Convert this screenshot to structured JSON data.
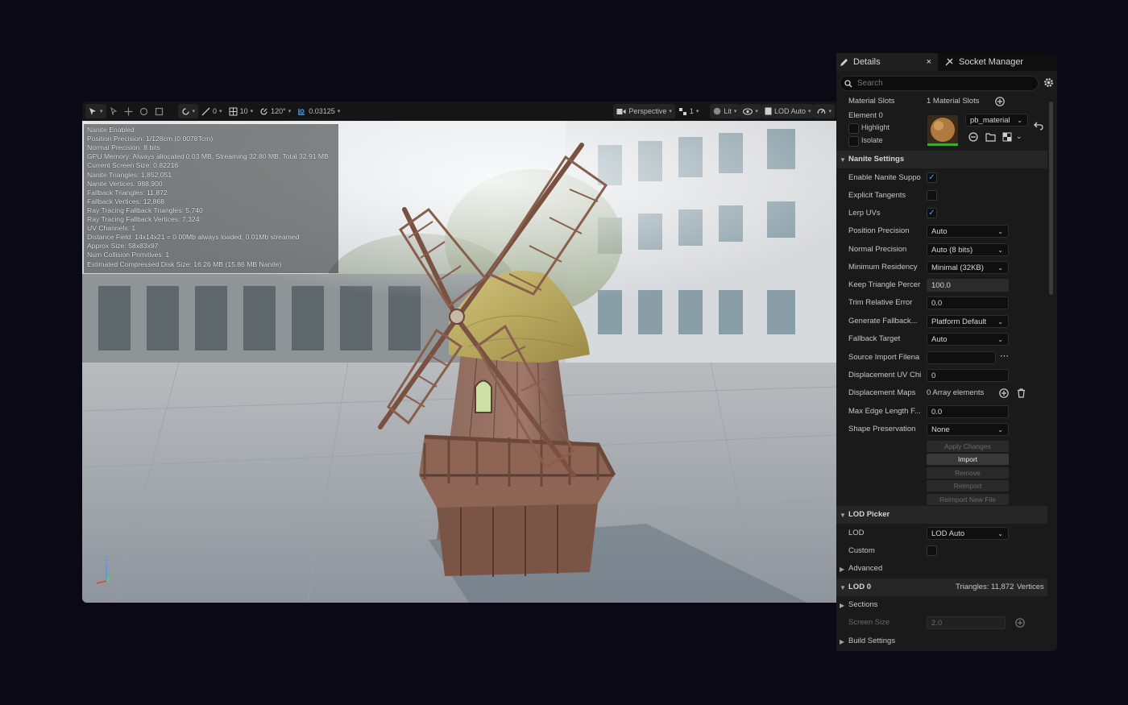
{
  "viewport": {
    "toolbar": {
      "snap_rotate": "0",
      "snap_grid": "10",
      "snap_angle": "120°",
      "camera_speed": "0.03125",
      "view_mode": "Perspective",
      "layout": "1",
      "lighting": "Lit",
      "lod": "LOD Auto"
    },
    "stats": [
      "Nanite Enabled",
      "Position Precision: 1/128cm (0.0078Tcm)",
      "Normal Precision: 8 bits",
      "GPU Memory: Always allocated 0.03 MB, Streaming 32.80 MB, Total 32.91 MB",
      "Current Screen Size: 0.82216",
      "Nanite Triangles: 1,852,051",
      "Nanite Vertices: 988,900",
      "Fallback Triangles: 11,872",
      "Fallback Vertices: 12,868",
      "Ray Tracing Fallback Triangles: 5,740",
      "Ray Tracing Fallback Vertices: 7,324",
      "UV Channels: 1",
      "Distance Field: 14x14x21 = 0.00Mb always loaded, 0.01Mb streamed",
      "Approx Size: 58x83x97",
      "Num Collision Primitives: 1",
      "Estimated Compressed Disk Size: 16.26 MB (15.86 MB Nanite)"
    ],
    "axis": {
      "z": "Z"
    }
  },
  "panel": {
    "tabs": {
      "details": "Details",
      "close": "×",
      "socket_manager": "Socket Manager"
    },
    "search_placeholder": "Search",
    "material_slots": {
      "label": "Material Slots",
      "value": "1 Material Slots"
    },
    "element": {
      "label": "Element 0",
      "highlight": "Highlight",
      "isolate": "Isolate",
      "material": "pb_material"
    },
    "nanite": {
      "title": "Nanite Settings",
      "enable": {
        "label": "Enable Nanite Suppo",
        "checked": "✓"
      },
      "explicit_tangents": {
        "label": "Explicit Tangents",
        "checked": ""
      },
      "lerp_uvs": {
        "label": "Lerp UVs",
        "checked": "✓"
      },
      "position_precision": {
        "label": "Position Precision",
        "value": "Auto"
      },
      "normal_precision": {
        "label": "Normal Precision",
        "value": "Auto (8 bits)"
      },
      "min_residency": {
        "label": "Minimum Residency",
        "value": "Minimal (32KB)"
      },
      "keep_triangle": {
        "label": "Keep Triangle Percer",
        "value": "100.0"
      },
      "trim_error": {
        "label": "Trim Relative Error",
        "value": "0.0"
      },
      "gen_fallback": {
        "label": "Generate Fallback...",
        "value": "Platform Default"
      },
      "fallback_target": {
        "label": "Fallback Target",
        "value": "Auto"
      },
      "source_import": {
        "label": "Source Import Filena",
        "value": ""
      },
      "displacement_uv": {
        "label": "Displacement UV Chi",
        "value": "0"
      },
      "displacement_maps": {
        "label": "Displacement Maps",
        "value": "0 Array elements"
      },
      "max_edge": {
        "label": "Max Edge Length F...",
        "value": "0.0"
      },
      "shape_preservation": {
        "label": "Shape Preservation",
        "value": "None"
      },
      "buttons": {
        "apply": "Apply Changes",
        "import": "Import",
        "remove": "Remove",
        "reimport": "Reimport",
        "reimport_new": "Reimport New File"
      }
    },
    "lod_picker": {
      "title": "LOD Picker",
      "lod": {
        "label": "LOD",
        "value": "LOD Auto"
      },
      "custom": {
        "label": "Custom",
        "checked": ""
      },
      "advanced": "Advanced"
    },
    "lod0": {
      "title": "LOD 0",
      "summary": "Triangles: 11,872",
      "summary2": "Vertices",
      "sections": "Sections",
      "screen_size": {
        "label": "Screen Size",
        "value": "2.0"
      },
      "build_settings": "Build Settings"
    }
  }
}
